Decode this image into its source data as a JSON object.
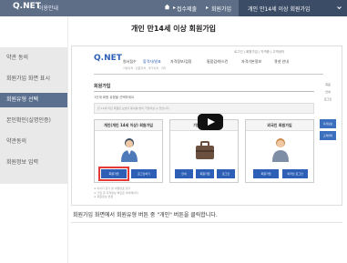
{
  "header": {
    "logo": "Q.NET",
    "logo_sub": "이용안내",
    "crumbs": [
      "접수제출",
      "회원가입",
      "개인 만14세 이상 회원가입"
    ],
    "separator": "▸"
  },
  "lesson_title": "개인 만14세 이상 회원가입",
  "sidebar": {
    "items": [
      {
        "label": "약관 동의"
      },
      {
        "label": "회원가입 화면 표시"
      },
      {
        "label": "회원유형 선택"
      },
      {
        "label": "본인확인(실명인증)"
      },
      {
        "label": "약관동의"
      },
      {
        "label": "회원정보 입력"
      }
    ],
    "active_index": 2
  },
  "embedded_site": {
    "logo": "Q.NET",
    "util_links": "로그인 | 회원가입 | 자격증 | 고객센터",
    "nav": [
      "원서접수",
      "합격자/발표",
      "자격정보/검정",
      "통합검색/스킨",
      "자격기본정보",
      "큐넷 안내"
    ],
    "nav_selected_index": 1,
    "subnav": "기술자격 · 전문자격 · 국가자격 · 기타",
    "page_heading": "회원가입",
    "step_text": "1단계 회원 유형을 선택하세요",
    "notice": "만 14세 미만 회원은 보호자 동의를 받아 가입하실 수 있습니다.",
    "cards": [
      {
        "title": "개인(개인 14세 이상) 회원가입",
        "buttons": [
          "회원가입",
          "로그인하기"
        ]
      },
      {
        "title": "기업회원 가입",
        "buttons": [
          "안내",
          "회원가입",
          "로그인"
        ]
      },
      {
        "title": "외국인 회원가입",
        "buttons": [
          "회원가입",
          "외국인 로그인"
        ]
      }
    ],
    "footnotes": [
      "※ 아이디 찾기 및 비밀번호 찾기",
      "※ 가입 후 자격정보 확인은 마이페이지",
      "※ 회원정보 변경"
    ],
    "right_rail": [
      "회원",
      "안내",
      "로그인",
      "자격정보",
      "고객센터"
    ]
  },
  "caption": "회원가입 화면에서 회원유형 버튼 중 \"개인\" 버튼을 클릭합니다.",
  "colors": {
    "topbar": "#5d6e86",
    "active_sidebar": "#5b6f8f",
    "brand_blue": "#2d5fb6",
    "highlight": "#e53935"
  }
}
